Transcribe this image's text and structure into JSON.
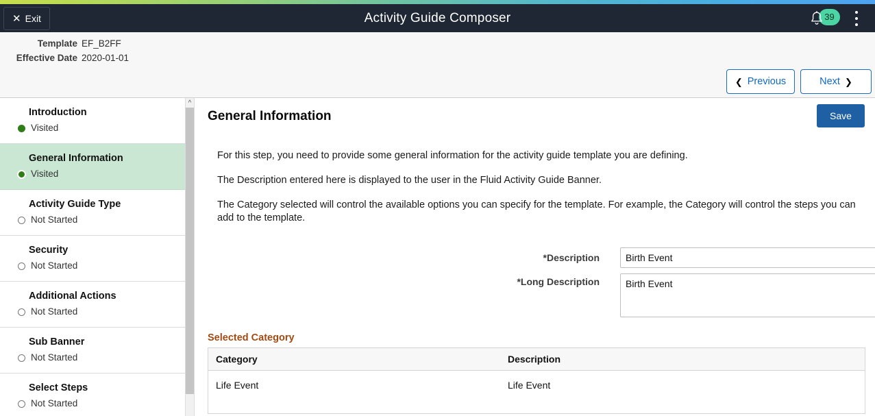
{
  "header": {
    "exit_label": "Exit",
    "exit_icon": "close-x-icon",
    "title": "Activity Guide Composer",
    "notification_icon": "bell-icon",
    "notification_count": "39",
    "notification_badge_color": "#4bd5a5",
    "menu_icon": "kebab-menu-icon",
    "background_color": "#1e2733"
  },
  "subheader": {
    "template_label": "Template",
    "template_value": "EF_B2FF",
    "effective_date_label": "Effective Date",
    "effective_date_value": "2020-01-01",
    "previous_label": "Previous",
    "previous_icon": "chevron-left-icon",
    "next_label": "Next",
    "next_icon": "chevron-right-icon",
    "button_accent": "#1068c9"
  },
  "sidebar": {
    "selected_background": "#c9e7d2",
    "visited_dot_color": "#2e7d17",
    "scrollbar": {
      "up_arrow_icon": "chevron-up-icon"
    },
    "items": [
      {
        "label": "Introduction",
        "status": "Visited",
        "state": "visited",
        "selected": false
      },
      {
        "label": "General Information",
        "status": "Visited",
        "state": "visited",
        "selected": true
      },
      {
        "label": "Activity Guide Type",
        "status": "Not Started",
        "state": "notstarted",
        "selected": false
      },
      {
        "label": "Security",
        "status": "Not Started",
        "state": "notstarted",
        "selected": false
      },
      {
        "label": "Additional Actions",
        "status": "Not Started",
        "state": "notstarted",
        "selected": false
      },
      {
        "label": "Sub Banner",
        "status": "Not Started",
        "state": "notstarted",
        "selected": false
      },
      {
        "label": "Select Steps",
        "status": "Not Started",
        "state": "notstarted",
        "selected": false
      }
    ]
  },
  "main": {
    "page_title": "General Information",
    "save_label": "Save",
    "save_color": "#1f5fa4",
    "paragraphs": [
      "For this step, you need to provide some general information for the activity guide template you are defining.",
      "The Description entered here is displayed to the user in the Fluid Activity Guide Banner.",
      "The Category selected will control the available options you can specify for the template. For example, the Category will control the steps you can add to the template."
    ],
    "form": {
      "description_label": "*Description",
      "description_value": "Birth Event",
      "description_placeholder": "",
      "long_description_label": "*Long Description",
      "long_description_value": "Birth Event",
      "long_description_placeholder": ""
    },
    "selected_category": {
      "section_title": "Selected Category",
      "section_title_color": "#a34a12",
      "columns": [
        "Category",
        "Description"
      ],
      "rows": [
        [
          "Life Event",
          "Life Event"
        ]
      ]
    }
  }
}
